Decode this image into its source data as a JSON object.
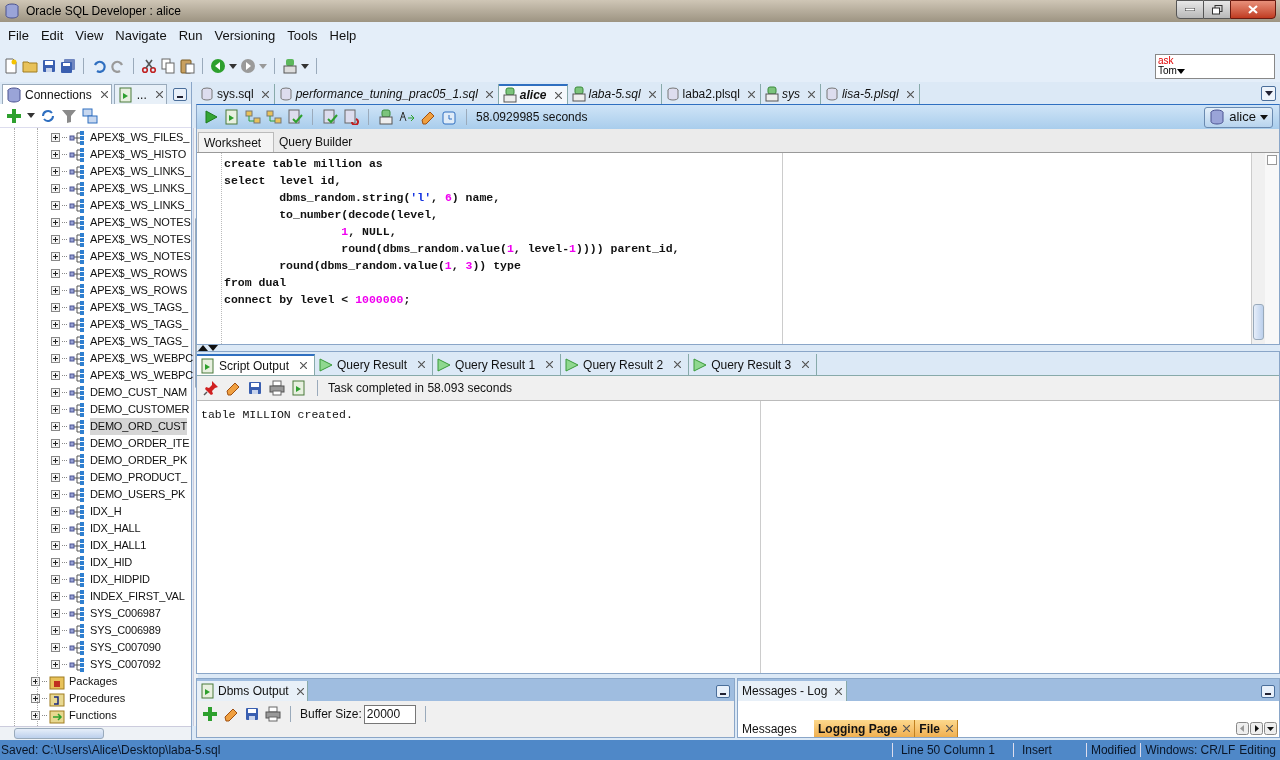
{
  "window": {
    "title": "Oracle SQL Developer : alice"
  },
  "menu": [
    {
      "label": "File"
    },
    {
      "label": "Edit"
    },
    {
      "label": "View"
    },
    {
      "label": "Navigate"
    },
    {
      "label": "Run"
    },
    {
      "label": "Versioning"
    },
    {
      "label": "Tools"
    },
    {
      "label": "Help"
    }
  ],
  "ask_tom": {
    "line_1": "ask",
    "line_2": "Tom"
  },
  "left_panel": {
    "tabs": [
      {
        "label": "Connections",
        "selected": true
      },
      {
        "label": "...",
        "selected": false
      }
    ],
    "tree": {
      "indexes": [
        {
          "label": "APEX$_WS_FILES_",
          "selected": false
        },
        {
          "label": "APEX$_WS_HISTO",
          "selected": false
        },
        {
          "label": "APEX$_WS_LINKS_",
          "selected": false
        },
        {
          "label": "APEX$_WS_LINKS_",
          "selected": false
        },
        {
          "label": "APEX$_WS_LINKS_",
          "selected": false
        },
        {
          "label": "APEX$_WS_NOTES",
          "selected": false
        },
        {
          "label": "APEX$_WS_NOTES",
          "selected": false
        },
        {
          "label": "APEX$_WS_NOTES",
          "selected": false
        },
        {
          "label": "APEX$_WS_ROWS",
          "selected": false
        },
        {
          "label": "APEX$_WS_ROWS",
          "selected": false
        },
        {
          "label": "APEX$_WS_TAGS_",
          "selected": false
        },
        {
          "label": "APEX$_WS_TAGS_",
          "selected": false
        },
        {
          "label": "APEX$_WS_TAGS_",
          "selected": false
        },
        {
          "label": "APEX$_WS_WEBPC",
          "selected": false
        },
        {
          "label": "APEX$_WS_WEBPC",
          "selected": false
        },
        {
          "label": "DEMO_CUST_NAM",
          "selected": false
        },
        {
          "label": "DEMO_CUSTOMER",
          "selected": false
        },
        {
          "label": "DEMO_ORD_CUST",
          "selected": true
        },
        {
          "label": "DEMO_ORDER_ITE",
          "selected": false
        },
        {
          "label": "DEMO_ORDER_PK",
          "selected": false
        },
        {
          "label": "DEMO_PRODUCT_",
          "selected": false
        },
        {
          "label": "DEMO_USERS_PK",
          "selected": false
        },
        {
          "label": "IDX_H",
          "selected": false
        },
        {
          "label": "IDX_HALL",
          "selected": false
        },
        {
          "label": "IDX_HALL1",
          "selected": false
        },
        {
          "label": "IDX_HID",
          "selected": false
        },
        {
          "label": "IDX_HIDPID",
          "selected": false
        },
        {
          "label": "INDEX_FIRST_VAL",
          "selected": false
        },
        {
          "label": "SYS_C006987",
          "selected": false
        },
        {
          "label": "SYS_C006989",
          "selected": false
        },
        {
          "label": "SYS_C007090",
          "selected": false
        },
        {
          "label": "SYS_C007092",
          "selected": false
        }
      ],
      "folders": [
        {
          "label": "Packages",
          "kind": "packages"
        },
        {
          "label": "Procedures",
          "kind": "procedures"
        },
        {
          "label": "Functions",
          "kind": "functions"
        }
      ]
    }
  },
  "editor_tabs": [
    {
      "label": "sys.sql",
      "kind": "file",
      "italic": false,
      "selected": false
    },
    {
      "label": "performance_tuning_prac05_1.sql",
      "kind": "file",
      "italic": true,
      "selected": false
    },
    {
      "label": "alice",
      "kind": "connection",
      "italic": true,
      "selected": true
    },
    {
      "label": "laba-5.sql",
      "kind": "connection",
      "italic": true,
      "selected": false
    },
    {
      "label": "laba2.plsql",
      "kind": "file",
      "italic": false,
      "selected": false
    },
    {
      "label": "sys",
      "kind": "connection",
      "italic": true,
      "selected": false
    },
    {
      "label": "lisa-5.plsql",
      "kind": "file",
      "italic": true,
      "selected": false
    }
  ],
  "worksheet": {
    "elapsed": "58.0929985 seconds",
    "connection": "alice",
    "subtabs": [
      {
        "label": "Worksheet",
        "selected": true
      },
      {
        "label": "Query Builder",
        "selected": false
      }
    ],
    "code": [
      [
        {
          "text": "create table million as",
          "kind": "plain"
        }
      ],
      [
        {
          "text": "select  level id,",
          "kind": "plain"
        }
      ],
      [
        {
          "text": "        dbms_random.string(",
          "kind": "plain"
        },
        {
          "text": "'l'",
          "kind": "string"
        },
        {
          "text": ", ",
          "kind": "plain"
        },
        {
          "text": "6",
          "kind": "number"
        },
        {
          "text": ") name,",
          "kind": "plain"
        }
      ],
      [
        {
          "text": "        to_number(decode(level,",
          "kind": "plain"
        }
      ],
      [
        {
          "text": "                 1",
          "kind": "number"
        },
        {
          "text": ", NULL,",
          "kind": "plain"
        }
      ],
      [
        {
          "text": "                 round(dbms_random.value(",
          "kind": "plain"
        },
        {
          "text": "1",
          "kind": "number"
        },
        {
          "text": ", level-",
          "kind": "plain"
        },
        {
          "text": "1",
          "kind": "number"
        },
        {
          "text": ")))) parent_id,",
          "kind": "plain"
        }
      ],
      [
        {
          "text": "        round(dbms_random.value(",
          "kind": "plain"
        },
        {
          "text": "1",
          "kind": "number"
        },
        {
          "text": ", ",
          "kind": "plain"
        },
        {
          "text": "3",
          "kind": "number"
        },
        {
          "text": ")) type",
          "kind": "plain"
        }
      ],
      [
        {
          "text": "from dual",
          "kind": "plain"
        }
      ],
      [
        {
          "text": "connect by level < ",
          "kind": "plain"
        },
        {
          "text": "1000000",
          "kind": "number"
        },
        {
          "text": ";",
          "kind": "plain"
        }
      ]
    ]
  },
  "output": {
    "tabs": [
      {
        "label": "Script Output",
        "kind": "script",
        "selected": true
      },
      {
        "label": "Query Result",
        "kind": "query",
        "selected": false
      },
      {
        "label": "Query Result 1",
        "kind": "query",
        "selected": false
      },
      {
        "label": "Query Result 2",
        "kind": "query",
        "selected": false
      },
      {
        "label": "Query Result 3",
        "kind": "query",
        "selected": false
      }
    ],
    "status": "Task completed in 58.093 seconds",
    "text": "table MILLION created."
  },
  "dbms_output": {
    "title": "Dbms Output",
    "buffer_label": "Buffer Size:",
    "buffer_value": "20000"
  },
  "messages_log": {
    "title": "Messages - Log",
    "tabs": [
      {
        "label": "Messages",
        "kind": "label"
      },
      {
        "label": "Logging Page",
        "kind": "tab"
      },
      {
        "label": "File",
        "kind": "tab"
      }
    ]
  },
  "status_bar": {
    "saved": "Saved: C:\\Users\\Alice\\Desktop\\laba-5.sql",
    "position": "Line 50 Column 1",
    "mode": "Insert",
    "modified": "Modified",
    "line_endings": "Windows: CR/LF",
    "state": "Editing"
  }
}
